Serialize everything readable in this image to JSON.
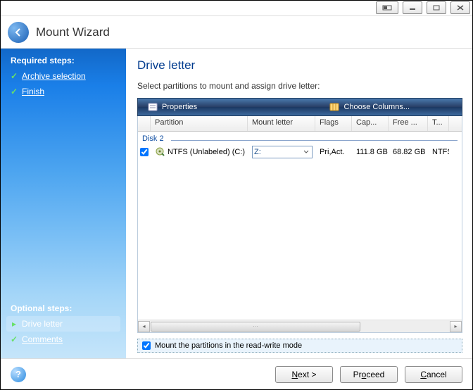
{
  "window": {
    "title": "Mount Wizard"
  },
  "sidebar": {
    "required_heading": "Required steps:",
    "optional_heading": "Optional steps:",
    "required": [
      {
        "label": "Archive selection"
      },
      {
        "label": "Finish"
      }
    ],
    "optional": [
      {
        "label": "Drive letter"
      },
      {
        "label": "Comments"
      }
    ]
  },
  "content": {
    "heading": "Drive letter",
    "instruction": "Select partitions to mount and assign drive letter:",
    "toolbar": {
      "properties": "Properties",
      "columns": "Choose Columns..."
    },
    "columns": {
      "partition": "Partition",
      "mount": "Mount letter",
      "flags": "Flags",
      "cap": "Cap...",
      "free": "Free ...",
      "type": "T..."
    },
    "group": "Disk 2",
    "row": {
      "checked": true,
      "partition": "NTFS (Unlabeled) (C:)",
      "mount_letter": "Z:",
      "flags": "Pri,Act.",
      "capacity": "111.8 GB",
      "free": "68.82 GB",
      "type": "NTFS"
    },
    "readwrite_label": "Mount the partitions in the read-write mode"
  },
  "footer": {
    "next": "Next >",
    "proceed": "Proceed",
    "cancel": "Cancel"
  }
}
